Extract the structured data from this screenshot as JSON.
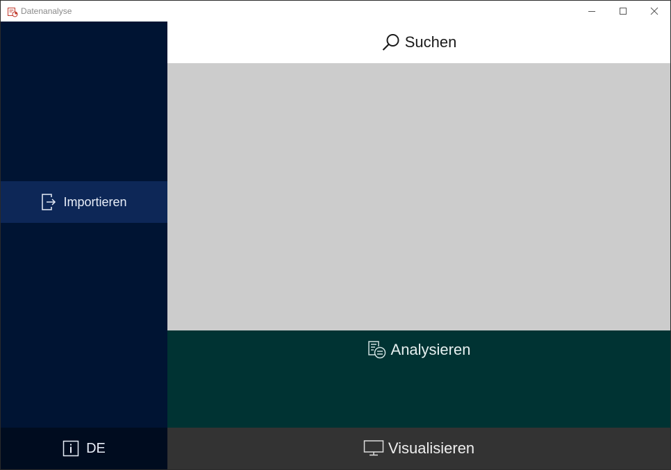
{
  "window": {
    "title": "Datenanalyse",
    "app_icon": "chart-document-icon",
    "controls": {
      "minimize_icon": "minimize-icon",
      "maximize_icon": "maximize-icon",
      "close_icon": "close-icon"
    }
  },
  "search": {
    "label": "Suchen",
    "icon": "search-icon"
  },
  "sidebar": {
    "items": [
      {
        "label": "Importieren",
        "icon": "import-icon",
        "selected": true
      }
    ],
    "footer": {
      "label": "DE",
      "icon": "info-icon"
    }
  },
  "panels": {
    "analyze": {
      "label": "Analysieren",
      "icon": "analyze-icon"
    },
    "visualize": {
      "label": "Visualisieren",
      "icon": "monitor-icon"
    }
  },
  "colors": {
    "sidebar_bg": "#001433",
    "sidebar_selected_bg": "#0d2757",
    "sidebar_footer_bg": "#000c1f",
    "content_bg": "#cccccc",
    "analyze_bg": "#003333",
    "visualize_bg": "#333333",
    "search_bg": "#ffffff"
  }
}
